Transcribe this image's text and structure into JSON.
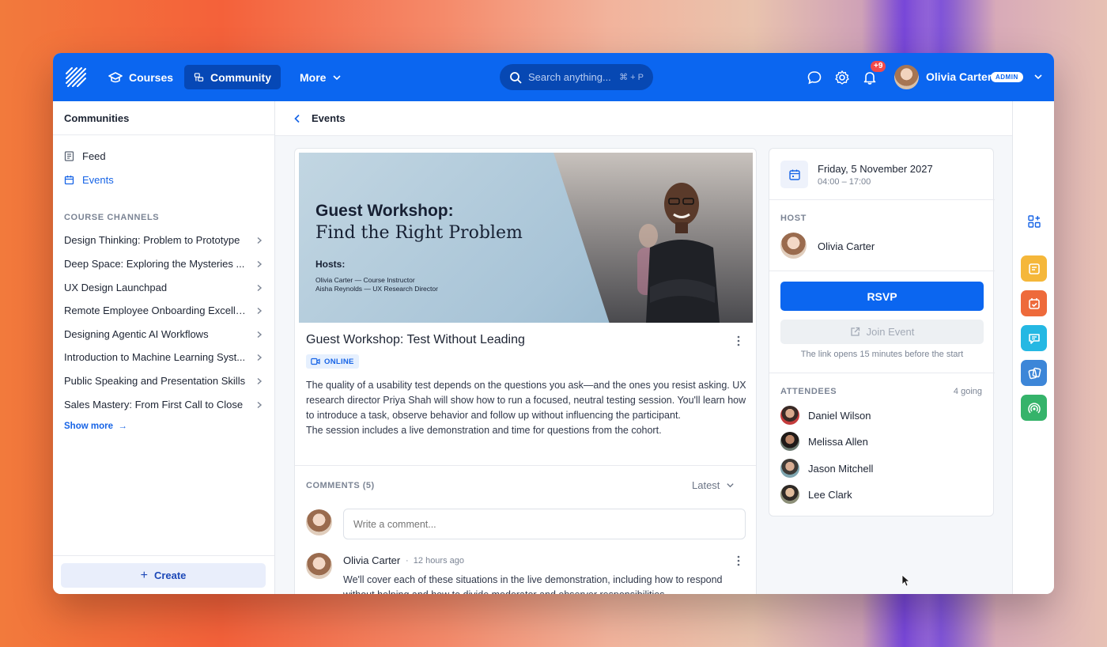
{
  "nav": {
    "courses_label": "Courses",
    "community_label": "Community",
    "more_label": "More",
    "search_placeholder": "Search anything...",
    "search_shortcut": "⌘ + P",
    "notifications_count": "+9",
    "user_name": "Olivia Carter",
    "user_role": "ADMIN"
  },
  "sidebar": {
    "title": "Communities",
    "items": [
      {
        "label": "Feed",
        "icon": "feed-icon",
        "active": false
      },
      {
        "label": "Events",
        "icon": "calendar-icon",
        "active": true
      }
    ],
    "section_title": "COURSE CHANNELS",
    "channels": [
      "Design Thinking: Problem to Prototype",
      "Deep Space: Exploring the Mysteries ...",
      "UX Design Launchpad",
      "Remote Employee Onboarding Excelle...",
      "Designing Agentic AI Workflows",
      "Introduction to Machine Learning Syst...",
      "Public Speaking and Presentation Skills",
      "Sales Mastery: From First Call to Close"
    ],
    "show_more": "Show more",
    "create_label": "Create"
  },
  "page": {
    "back_title": "Events"
  },
  "event": {
    "banner": {
      "title": "Guest Workshop:",
      "subtitle": "Find the Right Problem",
      "hosts_label": "Hosts:",
      "hosts": [
        "Olivia Carter — Course Instructor",
        "Aisha Reynolds — UX Research Director"
      ]
    },
    "title": "Guest Workshop: Test Without Leading",
    "mode": "ONLINE",
    "description": [
      "The quality of a usability test depends on the questions you ask—and the ones you resist asking. UX research director Priya Shah will show how to run a focused, neutral testing session. You'll learn how to introduce a task, observe behavior and follow up without influencing the participant.",
      "The session includes a live demonstration and time for questions from the cohort."
    ]
  },
  "comments": {
    "label": "COMMENTS (5)",
    "sort": "Latest",
    "input_placeholder": "Write a comment...",
    "items": [
      {
        "author": "Olivia Carter",
        "time": "12 hours ago",
        "text": "We'll cover each of these situations in the live demonstration, including how to respond without helping and how to divide moderator and observer responsibilities."
      }
    ]
  },
  "details": {
    "date": "Friday, 5 November 2027",
    "time": "04:00 – 17:00",
    "host_label": "HOST",
    "host_name": "Olivia Carter",
    "rsvp_label": "RSVP",
    "join_label": "Join Event",
    "join_note": "The link opens 15 minutes before the start",
    "attendees_label": "ATTENDEES",
    "going": "4 going",
    "attendees": [
      "Daniel Wilson",
      "Melissa Allen",
      "Jason Mitchell",
      "Lee Clark"
    ]
  },
  "rail_apps": [
    "widgets-icon",
    "notes-app-icon",
    "calendar-app-icon",
    "chat-app-icon",
    "cards-app-icon",
    "broadcast-app-icon"
  ],
  "colors": {
    "primary": "#0b66f0",
    "primary_dark": "#0648b6",
    "badge": "#f04a4a"
  }
}
